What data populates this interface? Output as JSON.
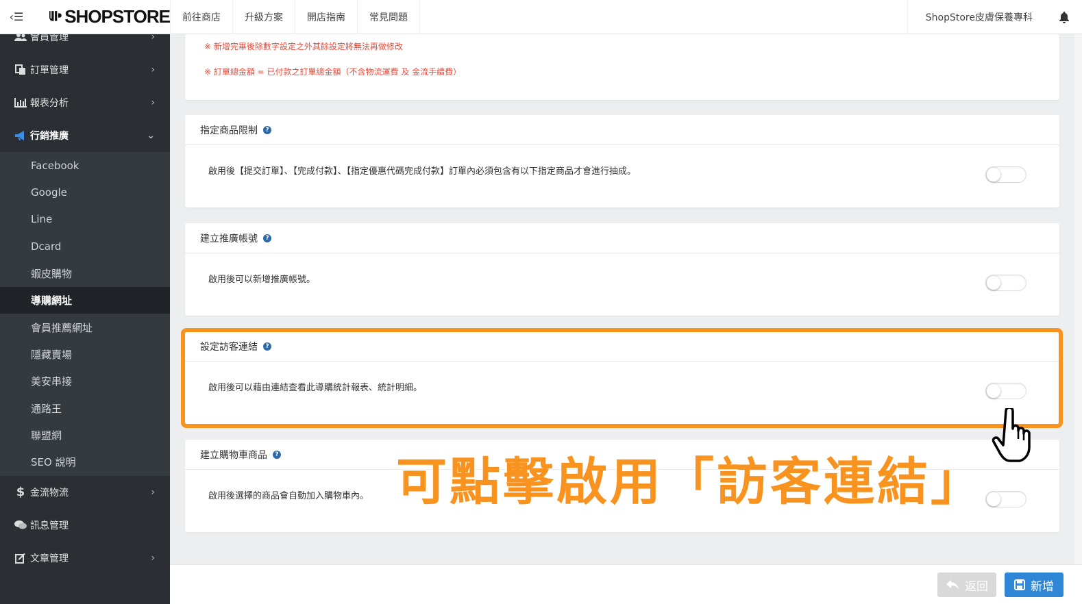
{
  "header": {
    "logo_text": "SHOPSTORE",
    "nav": [
      "前往商店",
      "升級方案",
      "開店指南",
      "常見問題"
    ],
    "store_name": "ShopStore皮膚保養專科"
  },
  "sidebar": {
    "items_top": [
      {
        "label": "會員管理",
        "icon": "users-icon"
      },
      {
        "label": "訂單管理",
        "icon": "copy-icon"
      },
      {
        "label": "報表分析",
        "icon": "bar-chart-icon"
      },
      {
        "label": "行銷推廣",
        "icon": "bullhorn-icon"
      }
    ],
    "sub_items": [
      "Facebook",
      "Google",
      "Line",
      "Dcard",
      "蝦皮購物",
      "導購網址",
      "會員推薦網址",
      "隱藏賣場",
      "美安串接",
      "通路王",
      "聯盟網",
      "SEO 說明"
    ],
    "current_sub": "導購網址",
    "items_bottom": [
      {
        "label": "金流物流",
        "icon": "dollar-icon"
      },
      {
        "label": "訊息管理",
        "icon": "comments-icon"
      },
      {
        "label": "文章管理",
        "icon": "edit-icon"
      }
    ]
  },
  "notes": [
    "※ 新增完畢後除數字設定之外其餘設定將無法再做修改",
    "※ 訂單總金額 = 已付款之訂單總金額（不含物流運費 及 金流手續費）"
  ],
  "cards": [
    {
      "title": "指定商品限制",
      "desc": "啟用後【提交訂單】、【完成付款】、【指定優惠代碼完成付款】訂單內必須包含有以下指定商品才會進行抽成。",
      "enabled": false
    },
    {
      "title": "建立推廣帳號",
      "desc": "啟用後可以新增推廣帳號。",
      "enabled": false
    },
    {
      "title": "設定訪客連結",
      "desc": "啟用後可以藉由連結查看此導購統計報表、統計明細。",
      "enabled": false
    },
    {
      "title": "建立購物車商品",
      "desc": "啟用後選擇的商品會自動加入購物車內。",
      "enabled": false
    }
  ],
  "callout": "可點擊啟用「訪客連結」",
  "footer": {
    "back_label": "返回",
    "add_label": "新增"
  },
  "colors": {
    "accent": "#f7931e",
    "primary": "#2f86d6",
    "sidebar": "#2b2f33"
  }
}
